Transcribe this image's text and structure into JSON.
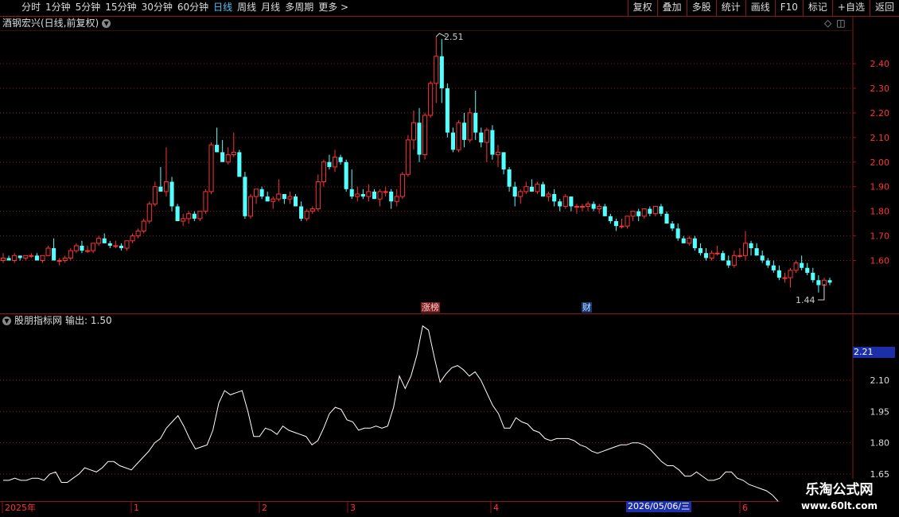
{
  "topbar": {
    "periods": [
      "分时",
      "1分钟",
      "5分钟",
      "15分钟",
      "30分钟",
      "60分钟",
      "日线",
      "周线",
      "月线",
      "多周期",
      "更多 >"
    ],
    "active_period": "日线",
    "tools": [
      "复权",
      "叠加",
      "多股",
      "统计",
      "画线",
      "F10",
      "标记",
      "+自选",
      "返回"
    ]
  },
  "main_chart": {
    "title": "酒钢宏兴(日线,前复权)",
    "high_label": "2.51",
    "low_label": "1.44",
    "y_ticks": [
      "2.40",
      "2.30",
      "2.20",
      "2.10",
      "2.00",
      "1.90",
      "1.80",
      "1.70",
      "1.60"
    ],
    "tags": {
      "zhangbang": "涨榜",
      "cai": "财"
    }
  },
  "indicator": {
    "title": "股朋指标网",
    "output_label": "输出: 1.50",
    "y_ticks": [
      "2.10",
      "1.95",
      "1.80",
      "1.65"
    ],
    "current_box": "2.21"
  },
  "timeline": {
    "labels": [
      "2025年",
      "1",
      "2",
      "3",
      "4",
      "6"
    ],
    "cursor_date": "2026/05/06/三"
  },
  "watermark": {
    "title": "乐淘公式网",
    "url": "www.60lt.com"
  },
  "colors": {
    "up": "#ff3333",
    "down": "#54ffff",
    "grid": "#8b1a1a",
    "indicator_line": "#ffffff"
  },
  "chart_data": {
    "type": "candlestick",
    "y_range_main": [
      1.44,
      2.51
    ],
    "candles": [
      [
        1.6,
        1.63,
        1.59,
        1.61
      ],
      [
        1.61,
        1.62,
        1.6,
        1.6
      ],
      [
        1.6,
        1.63,
        1.59,
        1.62
      ],
      [
        1.62,
        1.62,
        1.6,
        1.61
      ],
      [
        1.61,
        1.62,
        1.6,
        1.62
      ],
      [
        1.62,
        1.63,
        1.61,
        1.62
      ],
      [
        1.62,
        1.63,
        1.61,
        1.6
      ],
      [
        1.6,
        1.62,
        1.59,
        1.62
      ],
      [
        1.62,
        1.66,
        1.62,
        1.65
      ],
      [
        1.65,
        1.69,
        1.63,
        1.6
      ],
      [
        1.6,
        1.61,
        1.58,
        1.6
      ],
      [
        1.6,
        1.62,
        1.59,
        1.61
      ],
      [
        1.61,
        1.65,
        1.6,
        1.64
      ],
      [
        1.64,
        1.67,
        1.63,
        1.66
      ],
      [
        1.66,
        1.68,
        1.63,
        1.64
      ],
      [
        1.64,
        1.66,
        1.63,
        1.64
      ],
      [
        1.64,
        1.67,
        1.63,
        1.67
      ],
      [
        1.67,
        1.7,
        1.66,
        1.69
      ],
      [
        1.69,
        1.71,
        1.67,
        1.67
      ],
      [
        1.67,
        1.68,
        1.65,
        1.66
      ],
      [
        1.66,
        1.68,
        1.65,
        1.66
      ],
      [
        1.66,
        1.67,
        1.64,
        1.65
      ],
      [
        1.65,
        1.68,
        1.64,
        1.68
      ],
      [
        1.68,
        1.71,
        1.67,
        1.7
      ],
      [
        1.7,
        1.73,
        1.69,
        1.72
      ],
      [
        1.72,
        1.77,
        1.71,
        1.76
      ],
      [
        1.76,
        1.84,
        1.75,
        1.83
      ],
      [
        1.83,
        1.92,
        1.82,
        1.9
      ],
      [
        1.9,
        1.98,
        1.88,
        1.88
      ],
      [
        1.88,
        2.06,
        1.86,
        1.92
      ],
      [
        1.92,
        1.94,
        1.8,
        1.82
      ],
      [
        1.82,
        1.83,
        1.76,
        1.76
      ],
      [
        1.76,
        1.79,
        1.74,
        1.77
      ],
      [
        1.77,
        1.8,
        1.75,
        1.79
      ],
      [
        1.79,
        1.8,
        1.76,
        1.77
      ],
      [
        1.77,
        1.8,
        1.76,
        1.8
      ],
      [
        1.8,
        1.89,
        1.79,
        1.88
      ],
      [
        1.88,
        2.08,
        1.87,
        2.07
      ],
      [
        2.07,
        2.14,
        2.04,
        2.04
      ],
      [
        2.04,
        2.09,
        2.01,
        2.0
      ],
      [
        2.0,
        2.06,
        1.99,
        2.03
      ],
      [
        2.03,
        2.12,
        2.02,
        2.04
      ],
      [
        2.04,
        2.05,
        1.96,
        1.94
      ],
      [
        1.94,
        1.96,
        1.77,
        1.78
      ],
      [
        1.78,
        1.87,
        1.77,
        1.86
      ],
      [
        1.86,
        1.89,
        1.83,
        1.89
      ],
      [
        1.89,
        1.9,
        1.85,
        1.86
      ],
      [
        1.86,
        1.88,
        1.84,
        1.84
      ],
      [
        1.84,
        1.86,
        1.81,
        1.85
      ],
      [
        1.85,
        1.93,
        1.84,
        1.87
      ],
      [
        1.87,
        1.87,
        1.83,
        1.85
      ],
      [
        1.85,
        1.88,
        1.83,
        1.86
      ],
      [
        1.86,
        1.87,
        1.83,
        1.82
      ],
      [
        1.82,
        1.84,
        1.76,
        1.77
      ],
      [
        1.77,
        1.81,
        1.76,
        1.8
      ],
      [
        1.8,
        1.82,
        1.79,
        1.81
      ],
      [
        1.81,
        1.95,
        1.8,
        1.92
      ],
      [
        1.92,
        2.01,
        1.9,
        2.0
      ],
      [
        2.0,
        2.03,
        1.97,
        1.98
      ],
      [
        1.98,
        2.05,
        1.96,
        2.02
      ],
      [
        2.02,
        2.03,
        1.99,
        2.0
      ],
      [
        2.0,
        2.01,
        1.88,
        1.89
      ],
      [
        1.89,
        1.97,
        1.85,
        1.86
      ],
      [
        1.86,
        1.9,
        1.84,
        1.87
      ],
      [
        1.87,
        1.89,
        1.85,
        1.86
      ],
      [
        1.86,
        1.91,
        1.84,
        1.88
      ],
      [
        1.88,
        1.89,
        1.85,
        1.85
      ],
      [
        1.85,
        1.89,
        1.82,
        1.88
      ],
      [
        1.88,
        1.9,
        1.86,
        1.88
      ],
      [
        1.88,
        1.89,
        1.81,
        1.84
      ],
      [
        1.84,
        1.89,
        1.82,
        1.86
      ],
      [
        1.86,
        1.96,
        1.85,
        1.95
      ],
      [
        1.95,
        2.11,
        1.94,
        2.09
      ],
      [
        2.09,
        2.21,
        2.05,
        2.16
      ],
      [
        2.16,
        2.22,
        2.0,
        2.03
      ],
      [
        2.03,
        2.2,
        2.01,
        2.19
      ],
      [
        2.19,
        2.33,
        2.18,
        2.32
      ],
      [
        2.32,
        2.51,
        2.24,
        2.43
      ],
      [
        2.43,
        2.5,
        2.24,
        2.3
      ],
      [
        2.3,
        2.32,
        2.1,
        2.12
      ],
      [
        2.12,
        2.14,
        2.04,
        2.05
      ],
      [
        2.05,
        2.17,
        2.04,
        2.16
      ],
      [
        2.16,
        2.2,
        2.06,
        2.09
      ],
      [
        2.09,
        2.22,
        2.08,
        2.2
      ],
      [
        2.2,
        2.29,
        2.09,
        2.12
      ],
      [
        2.12,
        2.14,
        2.06,
        2.08
      ],
      [
        2.08,
        2.14,
        2.0,
        2.13
      ],
      [
        2.13,
        2.15,
        2.01,
        2.03
      ],
      [
        2.03,
        2.07,
        1.98,
        2.04
      ],
      [
        2.04,
        2.04,
        1.95,
        1.97
      ],
      [
        1.97,
        1.98,
        1.88,
        1.9
      ],
      [
        1.9,
        1.92,
        1.82,
        1.86
      ],
      [
        1.86,
        1.89,
        1.83,
        1.88
      ],
      [
        1.88,
        1.92,
        1.87,
        1.9
      ],
      [
        1.9,
        1.93,
        1.88,
        1.88
      ],
      [
        1.88,
        1.92,
        1.87,
        1.91
      ],
      [
        1.91,
        1.92,
        1.86,
        1.86
      ],
      [
        1.86,
        1.88,
        1.84,
        1.87
      ],
      [
        1.87,
        1.89,
        1.82,
        1.84
      ],
      [
        1.84,
        1.85,
        1.8,
        1.82
      ],
      [
        1.82,
        1.87,
        1.81,
        1.86
      ],
      [
        1.86,
        1.86,
        1.8,
        1.82
      ],
      [
        1.82,
        1.83,
        1.79,
        1.82
      ],
      [
        1.82,
        1.83,
        1.8,
        1.82
      ],
      [
        1.82,
        1.84,
        1.8,
        1.83
      ],
      [
        1.83,
        1.84,
        1.8,
        1.81
      ],
      [
        1.81,
        1.83,
        1.79,
        1.82
      ],
      [
        1.82,
        1.83,
        1.78,
        1.78
      ],
      [
        1.78,
        1.79,
        1.75,
        1.76
      ],
      [
        1.76,
        1.77,
        1.72,
        1.74
      ],
      [
        1.74,
        1.77,
        1.73,
        1.74
      ],
      [
        1.74,
        1.78,
        1.73,
        1.78
      ],
      [
        1.78,
        1.8,
        1.76,
        1.8
      ],
      [
        1.8,
        1.81,
        1.76,
        1.78
      ],
      [
        1.78,
        1.81,
        1.77,
        1.81
      ],
      [
        1.81,
        1.82,
        1.78,
        1.79
      ],
      [
        1.79,
        1.82,
        1.78,
        1.82
      ],
      [
        1.82,
        1.83,
        1.78,
        1.79
      ],
      [
        1.79,
        1.8,
        1.75,
        1.75
      ],
      [
        1.75,
        1.76,
        1.72,
        1.73
      ],
      [
        1.73,
        1.75,
        1.68,
        1.69
      ],
      [
        1.69,
        1.7,
        1.67,
        1.67
      ],
      [
        1.67,
        1.7,
        1.66,
        1.69
      ],
      [
        1.69,
        1.7,
        1.64,
        1.65
      ],
      [
        1.65,
        1.67,
        1.62,
        1.63
      ],
      [
        1.63,
        1.65,
        1.6,
        1.61
      ],
      [
        1.61,
        1.64,
        1.6,
        1.63
      ],
      [
        1.63,
        1.66,
        1.62,
        1.63
      ],
      [
        1.63,
        1.64,
        1.6,
        1.6
      ],
      [
        1.6,
        1.62,
        1.57,
        1.58
      ],
      [
        1.58,
        1.64,
        1.57,
        1.62
      ],
      [
        1.62,
        1.65,
        1.61,
        1.62
      ],
      [
        1.62,
        1.72,
        1.6,
        1.67
      ],
      [
        1.67,
        1.68,
        1.62,
        1.65
      ],
      [
        1.65,
        1.67,
        1.62,
        1.62
      ],
      [
        1.62,
        1.64,
        1.59,
        1.6
      ],
      [
        1.6,
        1.61,
        1.57,
        1.58
      ],
      [
        1.58,
        1.6,
        1.55,
        1.56
      ],
      [
        1.56,
        1.58,
        1.52,
        1.53
      ],
      [
        1.53,
        1.55,
        1.51,
        1.53
      ],
      [
        1.53,
        1.57,
        1.49,
        1.56
      ],
      [
        1.56,
        1.6,
        1.55,
        1.59
      ],
      [
        1.59,
        1.62,
        1.56,
        1.57
      ],
      [
        1.57,
        1.59,
        1.54,
        1.55
      ],
      [
        1.55,
        1.57,
        1.51,
        1.52
      ],
      [
        1.52,
        1.54,
        1.47,
        1.5
      ],
      [
        1.5,
        1.53,
        1.44,
        1.52
      ],
      [
        1.52,
        1.53,
        1.5,
        1.51
      ]
    ],
    "indicator_range": [
      1.58,
      2.39
    ],
    "indicator_series": [
      1.62,
      1.62,
      1.63,
      1.62,
      1.62,
      1.63,
      1.63,
      1.62,
      1.65,
      1.66,
      1.61,
      1.61,
      1.63,
      1.65,
      1.68,
      1.67,
      1.66,
      1.68,
      1.71,
      1.71,
      1.69,
      1.68,
      1.67,
      1.7,
      1.73,
      1.76,
      1.8,
      1.82,
      1.87,
      1.9,
      1.93,
      1.88,
      1.82,
      1.77,
      1.78,
      1.79,
      1.86,
      1.99,
      2.05,
      2.03,
      2.04,
      2.05,
      1.95,
      1.83,
      1.83,
      1.87,
      1.86,
      1.84,
      1.88,
      1.86,
      1.85,
      1.84,
      1.83,
      1.79,
      1.81,
      1.87,
      1.94,
      1.97,
      1.96,
      1.91,
      1.9,
      1.86,
      1.87,
      1.87,
      1.88,
      1.87,
      1.88,
      1.97,
      2.12,
      2.06,
      2.12,
      2.22,
      2.36,
      2.34,
      2.21,
      2.09,
      2.13,
      2.16,
      2.17,
      2.15,
      2.12,
      2.14,
      2.1,
      2.04,
      1.98,
      1.94,
      1.87,
      1.87,
      1.92,
      1.9,
      1.89,
      1.86,
      1.85,
      1.82,
      1.81,
      1.82,
      1.82,
      1.82,
      1.81,
      1.79,
      1.78,
      1.76,
      1.75,
      1.76,
      1.77,
      1.78,
      1.79,
      1.79,
      1.8,
      1.8,
      1.79,
      1.77,
      1.74,
      1.71,
      1.69,
      1.69,
      1.67,
      1.64,
      1.64,
      1.66,
      1.64,
      1.62,
      1.62,
      1.63,
      1.66,
      1.66,
      1.63,
      1.62,
      1.6,
      1.59,
      1.58,
      1.57,
      1.55,
      1.52
    ]
  }
}
